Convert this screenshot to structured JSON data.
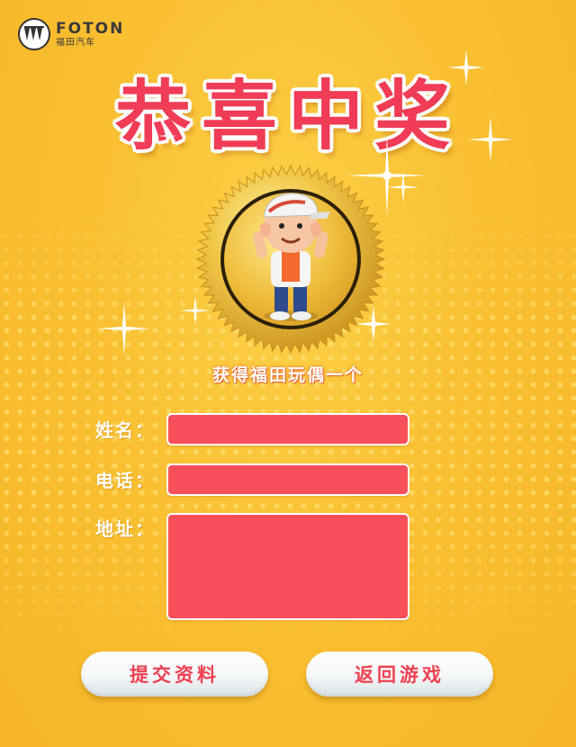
{
  "brand": {
    "name_en": "FOTON",
    "name_cn": "福田汽车"
  },
  "headline": "恭喜中奖",
  "prize": "获得福田玩偶一个",
  "form": {
    "name_label": "姓名：",
    "phone_label": "电话：",
    "address_label": "地址：",
    "name_value": "",
    "phone_value": "",
    "address_value": ""
  },
  "buttons": {
    "submit": "提交资料",
    "back": "返回游戏"
  },
  "colors": {
    "background": "#f9c133",
    "accent_red": "#f03c56",
    "field_fill": "#f84f5b",
    "medal_gold": "#e8b42a"
  }
}
